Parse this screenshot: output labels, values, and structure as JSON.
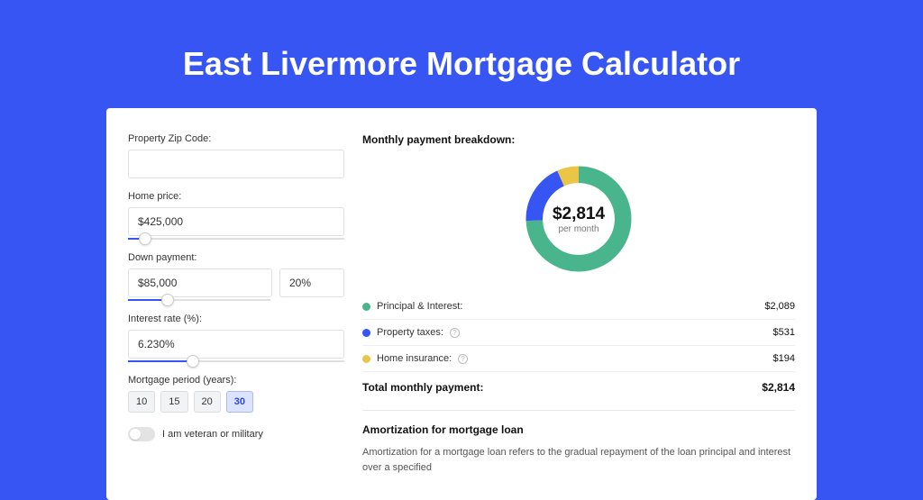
{
  "title": "East Livermore Mortgage Calculator",
  "form": {
    "zip_label": "Property Zip Code:",
    "zip_value": "",
    "home_price_label": "Home price:",
    "home_price_value": "$425,000",
    "down_payment_label": "Down payment:",
    "down_payment_value": "$85,000",
    "down_payment_pct": "20%",
    "interest_label": "Interest rate (%):",
    "interest_value": "6.230%",
    "period_label": "Mortgage period (years):",
    "periods": [
      "10",
      "15",
      "20",
      "30"
    ],
    "period_selected": "30",
    "veteran_label": "I am veteran or military"
  },
  "breakdown": {
    "title": "Monthly payment breakdown:",
    "center_amount": "$2,814",
    "center_sub": "per month",
    "items": [
      {
        "label": "Principal & Interest:",
        "amount": "$2,089"
      },
      {
        "label": "Property taxes:",
        "amount": "$531"
      },
      {
        "label": "Home insurance:",
        "amount": "$194"
      }
    ],
    "total_label": "Total monthly payment:",
    "total_amount": "$2,814"
  },
  "amortization": {
    "heading": "Amortization for mortgage loan",
    "body": "Amortization for a mortgage loan refers to the gradual repayment of the loan principal and interest over a specified"
  },
  "chart_data": {
    "type": "pie",
    "title": "Monthly payment breakdown",
    "series": [
      {
        "name": "Principal & Interest",
        "value": 2089,
        "color": "#49b58d"
      },
      {
        "name": "Property taxes",
        "value": 531,
        "color": "#3655f2"
      },
      {
        "name": "Home insurance",
        "value": 194,
        "color": "#eac547"
      }
    ],
    "total": 2814,
    "unit": "$/month"
  }
}
